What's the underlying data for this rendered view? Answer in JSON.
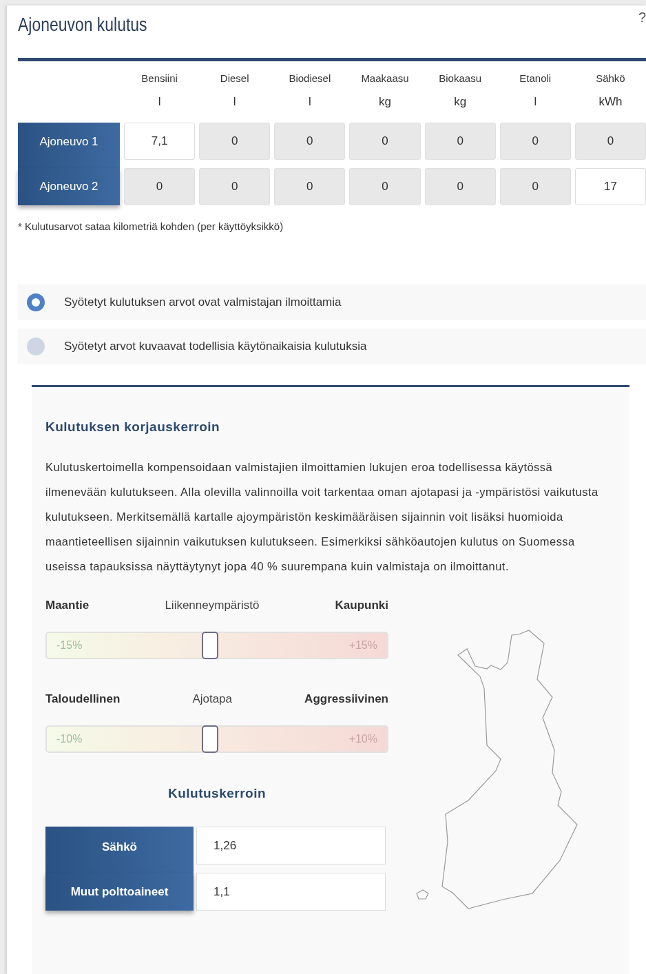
{
  "title": "Ajoneuvon kulutus",
  "help": "?",
  "consumption_table": {
    "columns": [
      {
        "fuel": "Bensiini",
        "unit": "l"
      },
      {
        "fuel": "Diesel",
        "unit": "l"
      },
      {
        "fuel": "Biodiesel",
        "unit": "l"
      },
      {
        "fuel": "Maakaasu",
        "unit": "kg"
      },
      {
        "fuel": "Biokaasu",
        "unit": "kg"
      },
      {
        "fuel": "Etanoli",
        "unit": "l"
      },
      {
        "fuel": "Sähkö",
        "unit": "kWh"
      }
    ],
    "rows": [
      {
        "vehicle": "Ajoneuvo 1",
        "cells": [
          {
            "value": "7,1",
            "disabled": false
          },
          {
            "value": "0",
            "disabled": true
          },
          {
            "value": "0",
            "disabled": true
          },
          {
            "value": "0",
            "disabled": true
          },
          {
            "value": "0",
            "disabled": true
          },
          {
            "value": "0",
            "disabled": true
          },
          {
            "value": "0",
            "disabled": true
          }
        ]
      },
      {
        "vehicle": "Ajoneuvo 2",
        "cells": [
          {
            "value": "0",
            "disabled": true
          },
          {
            "value": "0",
            "disabled": true
          },
          {
            "value": "0",
            "disabled": true
          },
          {
            "value": "0",
            "disabled": true
          },
          {
            "value": "0",
            "disabled": true
          },
          {
            "value": "0",
            "disabled": true
          },
          {
            "value": "17",
            "disabled": false
          }
        ]
      }
    ]
  },
  "note": "* Kulutusarvot sataa kilometriä kohden (per käyttöyksikkö)",
  "source_options": [
    {
      "label": "Syötetyt kulutuksen arvot ovat valmistajan ilmoittamia",
      "selected": true
    },
    {
      "label": "Syötetyt arvot kuvaavat todellisia käytönaikaisia kulutuksia",
      "selected": false
    }
  ],
  "correction": {
    "title": "Kulutuksen korjauskerroin",
    "description": "Kulutuskertoimella kompensoidaan valmistajien ilmoittamien lukujen eroa todellisessa käytössä ilmenevään kulutukseen. Alla olevilla valinnoilla voit tarkentaa oman ajotapasi ja -ympäristösi vaikutusta kulutukseen. Merkitsemällä kartalle ajoympäristön keskimääräisen sijainnin voit lisäksi huomioida maantieteellisen sijainnin vaikutuksen kulutukseen. Esimerkiksi sähköautojen kulutus on Suomessa useissa tapauksissa näyttäytynyt jopa 40 % suurempana kuin valmistaja on ilmoittanut.",
    "sliders": [
      {
        "left_label": "Maantie",
        "center_label": "Liikenneympäristö",
        "right_label": "Kaupunki",
        "min_label": "-15%",
        "max_label": "+15%",
        "level": 0.48
      },
      {
        "left_label": "Taloudellinen",
        "center_label": "Ajotapa",
        "right_label": "Aggressiivinen",
        "min_label": "-10%",
        "max_label": "+10%",
        "level": 0.48
      }
    ],
    "factor_title": "Kulutuskerroin",
    "factors": [
      {
        "label": "Sähkö",
        "value": "1,26"
      },
      {
        "label": "Muut polttoaineet",
        "value": "1,1"
      }
    ]
  }
}
